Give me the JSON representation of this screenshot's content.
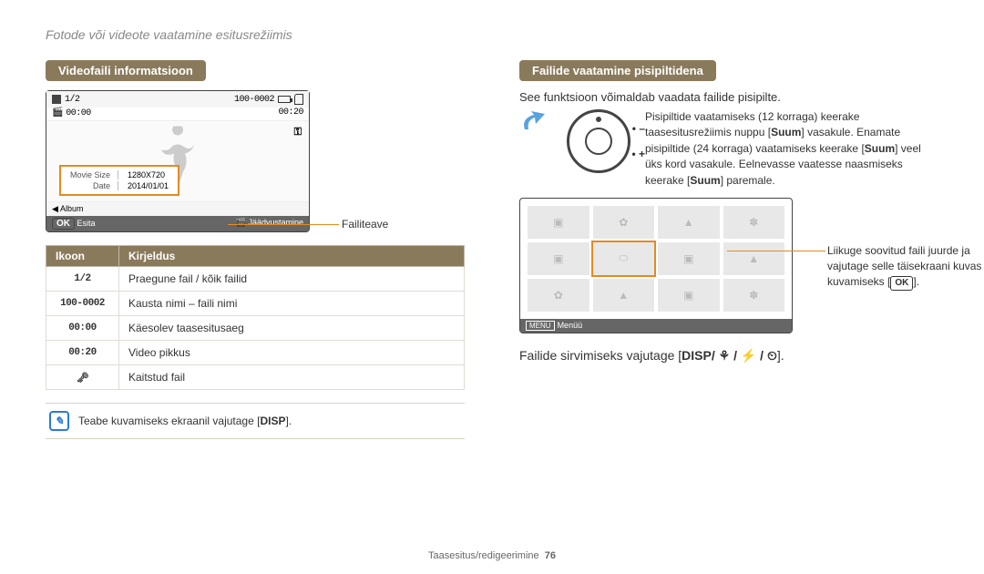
{
  "page_title": "Fotode või videote vaatamine esitusrežiimis",
  "footer_section": "Taasesitus/redigeerimine",
  "footer_page": "76",
  "left": {
    "heading": "Videofaili informatsioon",
    "screen": {
      "count": "1/2",
      "folder_file": "100-0002",
      "time_cur": "00:00",
      "time_total": "00:20",
      "info_rows": [
        {
          "k": "Movie Size",
          "v": "1280X720"
        },
        {
          "k": "Date",
          "v": "2014/01/01"
        }
      ],
      "album_label": "Album",
      "ok_label": "OK",
      "play_label": "Esita",
      "record_label": "Jäädvustamine"
    },
    "leader_label": "Failiteave",
    "table": {
      "head_icon": "Ikoon",
      "head_desc": "Kirjeldus",
      "rows": [
        {
          "icon": "1/2",
          "desc": "Praegune fail / kõik failid"
        },
        {
          "icon": "100-0002",
          "desc": "Kausta nimi – faili nimi"
        },
        {
          "icon": "00:00",
          "desc": "Käesolev taasesitusaeg"
        },
        {
          "icon": "00:20",
          "desc": "Video pikkus"
        },
        {
          "icon": "🗝",
          "desc": "Kaitstud fail"
        }
      ]
    },
    "tip_prefix": "Teabe kuvamiseks ekraanil vajutage [",
    "tip_bold": "DISP",
    "tip_suffix": "]."
  },
  "right": {
    "heading": "Failide vaatamine pisipiltidena",
    "intro": "See funktsioon võimaldab vaadata failide pisipilte.",
    "dial_p1": "Pisipiltide vaatamiseks (12 korraga) keerake taasesitusrežiimis nuppu [",
    "dial_b1": "Suum",
    "dial_p2": "] vasakule. Enamate pisipiltide (24 korraga) vaatamiseks keerake [",
    "dial_b2": "Suum",
    "dial_p3": "] veel üks kord vasakule. Eelnevasse vaatesse naasmiseks keerake [",
    "dial_b3": "Suum",
    "dial_p4": "] paremale.",
    "dial_minus": "–",
    "dial_plus": "+",
    "thumbnail_leader_1": "Liikuge soovitud faili juurde ja vajutage selle täisekraani kuvas kuvamiseks [",
    "thumbnail_ok": "OK",
    "thumbnail_leader_2": "].",
    "menu_tag": "MENU",
    "menu_label": "Menüü",
    "browse_prefix": "Failide sirvimiseks vajutage [",
    "browse_disp": "DISP",
    "browse_icons": "/ ⚘ / ⚡ / ⏲",
    "browse_suffix": "]."
  }
}
